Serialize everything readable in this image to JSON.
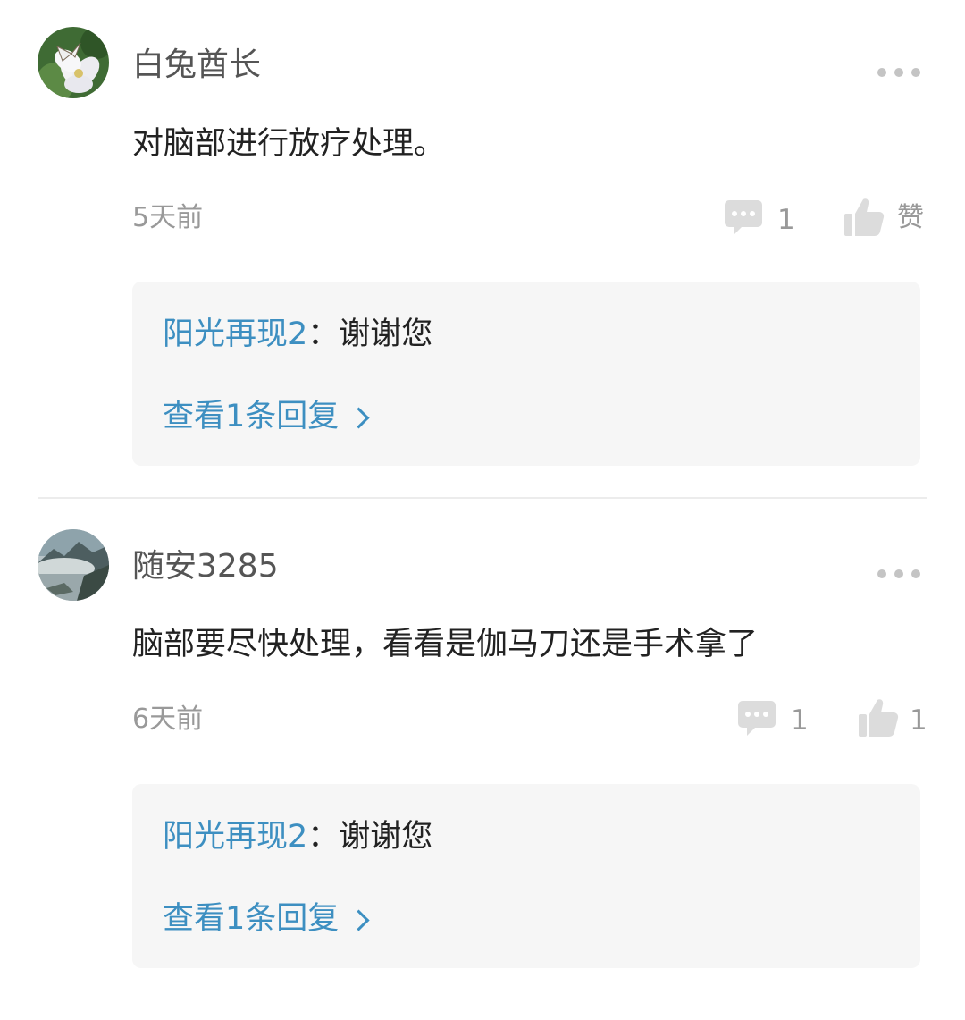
{
  "comments": [
    {
      "username": "白兔酋长",
      "avatar_icon": "white-flower-butterfly-avatar",
      "content": "对脑部进行放疗处理。",
      "time": "5天前",
      "reply_count": "1",
      "like_label": "赞",
      "reply": {
        "user": "阳光再现2",
        "separator": "：",
        "text": "谢谢您",
        "view_replies": "查看1条回复"
      }
    },
    {
      "username": "随安3285",
      "avatar_icon": "misty-mountain-lake-avatar",
      "content": "脑部要尽快处理，看看是伽马刀还是手术拿了",
      "time": "6天前",
      "reply_count": "1",
      "like_label": "1",
      "reply": {
        "user": "阳光再现2",
        "separator": "：",
        "text": "谢谢您",
        "view_replies": "查看1条回复"
      }
    }
  ],
  "colors": {
    "link_blue": "#3d8fc1",
    "meta_gray": "#999999",
    "username_gray": "#555555",
    "text_dark": "#222222",
    "reply_bg": "#f6f6f6"
  }
}
